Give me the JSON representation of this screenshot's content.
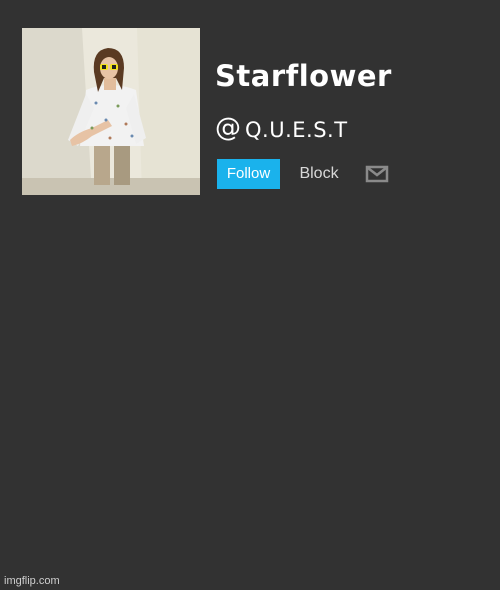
{
  "profile": {
    "display_name": "Starflower",
    "at_sign": "@",
    "handle": "Q.U.E.S.T",
    "avatar_icon": "profile-photo"
  },
  "actions": {
    "follow_label": "Follow",
    "block_label": "Block",
    "message_icon": "envelope-icon"
  },
  "watermark": "imgflip.com",
  "colors": {
    "background": "#323232",
    "follow_button": "#1ab2ec",
    "text": "#ffffff",
    "muted_text": "#d8d8d8",
    "icon": "#8a8a8a"
  }
}
